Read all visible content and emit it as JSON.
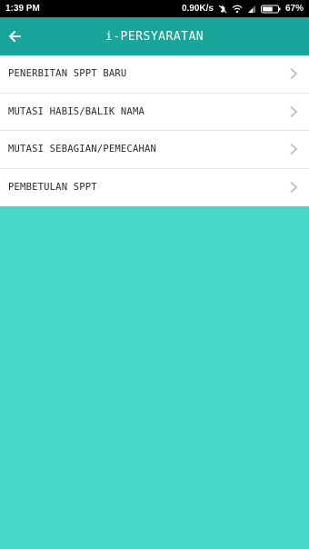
{
  "status_bar": {
    "time": "1:39 PM",
    "network_speed": "0.90K/s",
    "battery_percent": "67%",
    "battery_level": 0.67,
    "icons": [
      "bluetooth-icon",
      "wifi-icon",
      "signal-icon",
      "battery-icon"
    ]
  },
  "app_bar": {
    "title": "i-PERSYARATAN",
    "back_icon": "arrow-left-icon"
  },
  "menu": {
    "items": [
      {
        "label": "PENERBITAN SPPT BARU"
      },
      {
        "label": "MUTASI HABIS/BALIK NAMA"
      },
      {
        "label": "MUTASI SEBAGIAN/PEMECAHAN"
      },
      {
        "label": "PEMBETULAN SPPT"
      }
    ]
  },
  "colors": {
    "app_bar": "#1aa59a",
    "background": "#47d6c8",
    "list_background": "#ffffff",
    "chevron": "#b8b8b8"
  }
}
